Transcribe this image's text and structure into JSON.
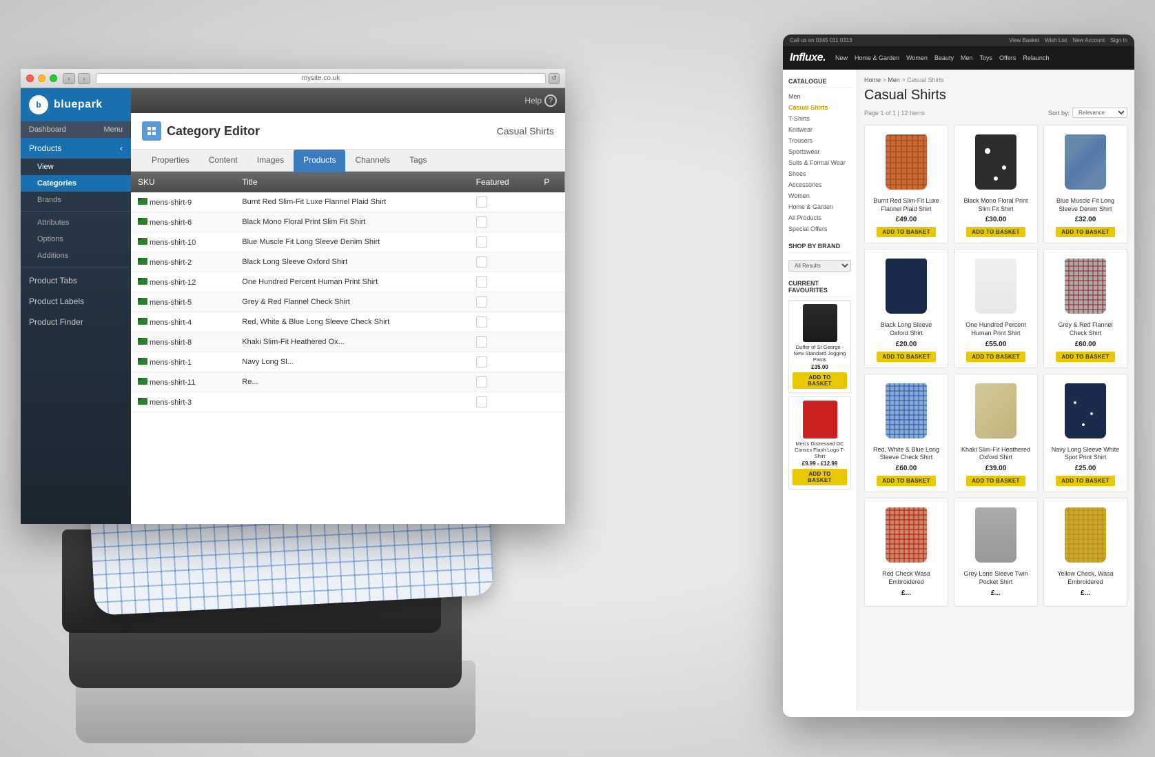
{
  "meta": {
    "background_color": "#e0ddd8"
  },
  "admin": {
    "window_title": "mysite.co.uk",
    "logo": "bluepark",
    "header": {
      "dashboard_label": "Dashboard",
      "menu_label": "Menu",
      "help_label": "Help",
      "products_label": "Products",
      "view_label": "View"
    },
    "sidebar_items": [
      {
        "label": "Dashboard",
        "active": false
      },
      {
        "label": "Products",
        "active": true
      },
      {
        "label": "View",
        "sub": true
      },
      {
        "label": "Categories",
        "sub": true,
        "active": true
      },
      {
        "label": "Brands",
        "sub": true
      },
      {
        "label": "Attributes",
        "sub": true
      },
      {
        "label": "Options",
        "sub": true
      },
      {
        "label": "Additions",
        "sub": true
      },
      {
        "label": "Product Tabs",
        "sub": false
      },
      {
        "label": "Product Labels",
        "sub": false
      },
      {
        "label": "Product Finder",
        "sub": false
      }
    ],
    "category_editor": {
      "title": "Category Editor",
      "record": "Casual Shirts"
    },
    "tabs": [
      {
        "label": "Properties",
        "active": false
      },
      {
        "label": "Content",
        "active": false
      },
      {
        "label": "Images",
        "active": false
      },
      {
        "label": "Products",
        "active": true
      },
      {
        "label": "Channels",
        "active": false
      },
      {
        "label": "Tags",
        "active": false
      }
    ],
    "table": {
      "columns": [
        "SKU",
        "Title",
        "Featured",
        "P"
      ],
      "rows": [
        {
          "sku": "mens-shirt-9",
          "title": "Burnt Red Slim-Fit Luxe Flannel Plaid Shirt"
        },
        {
          "sku": "mens-shirt-6",
          "title": "Black Mono Floral Print Slim Fit Shirt"
        },
        {
          "sku": "mens-shirt-10",
          "title": "Blue Muscle Fit Long Sleeve Denim Shirt"
        },
        {
          "sku": "mens-shirt-2",
          "title": "Black Long Sleeve Oxford Shirt"
        },
        {
          "sku": "mens-shirt-12",
          "title": "One Hundred Percent Human Print Shirt"
        },
        {
          "sku": "mens-shirt-5",
          "title": "Grey & Red Flannel Check Shirt"
        },
        {
          "sku": "mens-shirt-4",
          "title": "Red, White & Blue Long Sleeve Check Shirt"
        },
        {
          "sku": "mens-shirt-8",
          "title": "Khaki Slim-Fit Heathered Ox..."
        },
        {
          "sku": "mens-shirt-1",
          "title": "Navy Long Sl..."
        },
        {
          "sku": "mens-shirt-11",
          "title": "Re..."
        },
        {
          "sku": "mens-shirt-3",
          "title": ""
        }
      ]
    }
  },
  "store": {
    "topbar": {
      "phone": "Call us on 0345 011 0313",
      "links": [
        "View Basket",
        "Wish List",
        "New Account",
        "Sign In"
      ]
    },
    "logo": "Influxe.",
    "nav_items": [
      "New",
      "Home & Garden",
      "Women",
      "Beauty",
      "Men",
      "Toys",
      "Offers",
      "Relaunch"
    ],
    "sidebar": {
      "catalogue_title": "CATALOGUE",
      "catalogue_items": [
        {
          "label": "Men"
        },
        {
          "label": "Casual Shirts",
          "active": true
        },
        {
          "label": "T-Shirts"
        },
        {
          "label": "Knitwear"
        },
        {
          "label": "Trousers"
        },
        {
          "label": "Sportswear"
        },
        {
          "label": "Suits & Formal Wear"
        },
        {
          "label": "Shoes"
        },
        {
          "label": "Accessories"
        },
        {
          "label": "Women"
        },
        {
          "label": "Home & Garden"
        },
        {
          "label": "All Products"
        },
        {
          "label": "Special Offers"
        }
      ],
      "brands_title": "SHOP BY BRAND",
      "brands_filter": "All Results",
      "favourites_title": "CURRENT FAVOURITES",
      "favourites": [
        {
          "name": "Duffer of St George - New Standard Jogging Pants",
          "price": "£35.00",
          "color": "dark"
        },
        {
          "name": "Men's Distressed DC Comics Flash Logo T-Shirt",
          "price_range": "£9.99 - £12.99",
          "color": "red"
        }
      ]
    },
    "page": {
      "breadcrumb": "Home > Men > Casual Shirts",
      "title": "Casual Shirts",
      "meta": "Page 1 of 1 | 12 Items",
      "sort_by": "Sort by:",
      "products": [
        {
          "name": "Burnt Red Slim-Fit Luxe Flannel Plaid Shirt",
          "price": "£49.00",
          "style": "plaid",
          "row": 1
        },
        {
          "name": "Black Mono Floral Print Slim Fit Shirt",
          "price": "£30.00",
          "style": "mono-floral",
          "row": 1
        },
        {
          "name": "Blue Muscle Fit Long Sleeve Denim Shirt",
          "price": "£32.00",
          "style": "denim",
          "row": 1
        },
        {
          "name": "Black Long Sleeve Oxford Shirt",
          "price": "£20.00",
          "style": "oxford",
          "row": 2
        },
        {
          "name": "One Hundred Percent Human Print Shirt",
          "price": "£55.00",
          "style": "human-print",
          "row": 2
        },
        {
          "name": "Grey & Red Flannel Check Shirt",
          "price": "£60.00",
          "style": "flannel-check",
          "row": 2
        },
        {
          "name": "Red, White & Blue Long Sleeve Check Shirt",
          "price": "£60.00",
          "style": "blue-check",
          "row": 3
        },
        {
          "name": "Khaki Slim-Fit Heathered Oxford Shirt",
          "price": "£39.00",
          "style": "khaki",
          "row": 3
        },
        {
          "name": "Navy Long Sleeve White Spot Print Shirt",
          "price": "£25.00",
          "style": "navy-spot",
          "row": 3
        },
        {
          "name": "Red Check Wasa Embroidered",
          "price": "£...",
          "style": "red-check",
          "row": 4
        },
        {
          "name": "Grey Lone Sleeve Twin Pocket Shirt",
          "price": "£...",
          "style": "grey-pocket",
          "row": 4
        },
        {
          "name": "Yellow Check, Wasa Embroidered",
          "price": "£...",
          "style": "yellow-check",
          "row": 4
        }
      ]
    }
  }
}
